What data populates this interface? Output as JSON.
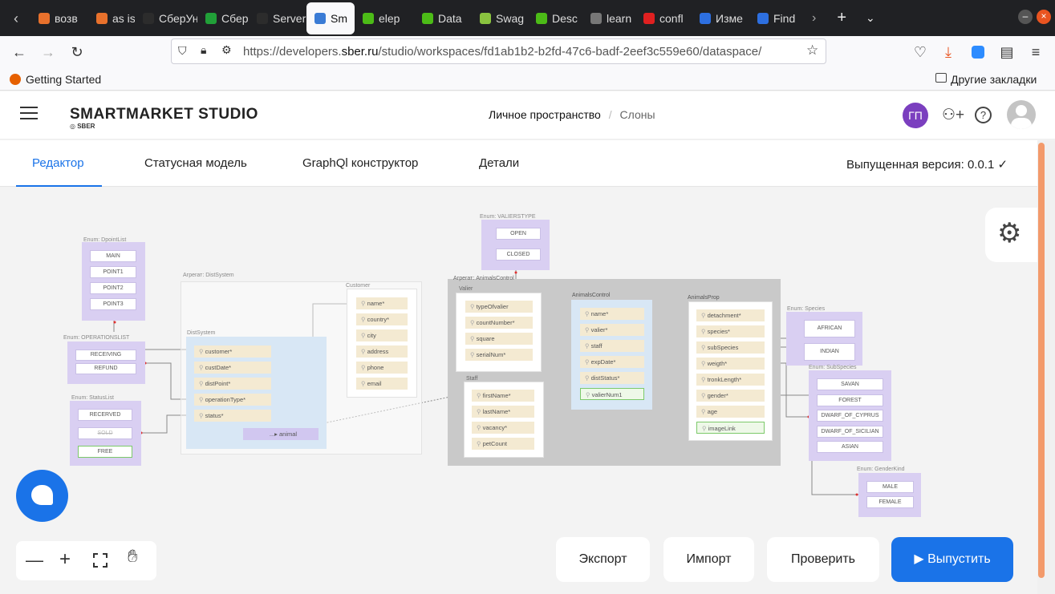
{
  "browser": {
    "tabs": [
      {
        "label": "возв",
        "color": "#e8712c"
      },
      {
        "label": "as is",
        "color": "#e8712c"
      },
      {
        "label": "СберУн",
        "color": "#2c2c2c"
      },
      {
        "label": "Сбер",
        "color": "#21a038"
      },
      {
        "label": "Server E",
        "color": "#2c2c2c"
      },
      {
        "label": "Sm",
        "color": "#3a7bd5"
      },
      {
        "label": "elep",
        "color": "#4cbb17"
      },
      {
        "label": "Data",
        "color": "#4cbb17"
      },
      {
        "label": "Swag",
        "color": "#8ac33f"
      },
      {
        "label": "Desc",
        "color": "#4cbb17"
      },
      {
        "label": "learn",
        "color": "#777777"
      },
      {
        "label": "confl",
        "color": "#e02020"
      },
      {
        "label": "Изме",
        "color": "#2d6fe0"
      },
      {
        "label": "Find",
        "color": "#2d6fe0"
      }
    ],
    "url_prefix": "https://developers.",
    "url_domain": "sber.ru",
    "url_suffix": "/studio/workspaces/fd1ab1b2-b2fd-47c6-badf-2eef3c559e60/dataspace/",
    "bookmark_getting_started": "Getting Started",
    "bookmark_other": "Другие закладки"
  },
  "app": {
    "logo": "SMARTMARKET STUDIO",
    "logo_sub": "SBER",
    "breadcrumb_space": "Личное пространство",
    "breadcrumb_sep": "/",
    "breadcrumb_project": "Слоны",
    "avatar_initials": "ГП",
    "accent": "#7b3fbf"
  },
  "subtabs": {
    "editor": "Редактор",
    "status_model": "Статусная модель",
    "graphql": "GraphQl конструктор",
    "details": "Детали",
    "version": "Выпущенная версия: 0.0.1"
  },
  "actions": {
    "export": "Экспорт",
    "import": "Импорт",
    "check": "Проверить",
    "release": "▶ Выпустить"
  },
  "diagram": {
    "enum_dpointlist": {
      "title": "Enum: DpointList",
      "values": [
        "MAIN",
        "POINT1",
        "POINT2",
        "POINT3"
      ]
    },
    "enum_operationslist": {
      "title": "Enum: OPERATIONSLIST",
      "values": [
        "RECEIVING",
        "REFUND"
      ]
    },
    "enum_statuslist": {
      "title": "Enum: StatusList",
      "values": [
        "RECERVED",
        "SOLD",
        "FREE"
      ]
    },
    "enum_valierstype": {
      "title": "Enum: VALIERSTYPE",
      "values": [
        "OPEN",
        "CLOSED"
      ]
    },
    "enum_species": {
      "title": "Enum: Species",
      "values": [
        "AFRICAN",
        "INDIAN"
      ]
    },
    "enum_subspecies": {
      "title": "Enum: SubSpecies",
      "values": [
        "SAVAN",
        "FOREST",
        "DWARF_OF_CYPRUS",
        "DWARF_OF_SICILIAN",
        "ASIAN"
      ]
    },
    "enum_genderkind": {
      "title": "Enum: GenderKind",
      "values": [
        "MALE",
        "FEMALE"
      ]
    },
    "agg_distsystem": "Агрегат: DistSystem",
    "agg_animalscontrol": "Агрегат: AnimalsControl",
    "distsystem": {
      "title": "DistSystem",
      "fields": [
        "customer*",
        "custDate*",
        "distPoint*",
        "operationType*",
        "status*"
      ],
      "extra": "animal"
    },
    "customer": {
      "title": "Customer",
      "fields": [
        "name*",
        "country*",
        "city",
        "address",
        "phone",
        "email"
      ]
    },
    "valier": {
      "title": "Valier",
      "fields": [
        "typeOfvalier",
        "countNumber*",
        "square",
        "serialNum*"
      ]
    },
    "staff": {
      "title": "Staff",
      "fields": [
        "firstName*",
        "lastName*",
        "vacancy*",
        "petCount"
      ]
    },
    "animalscontrol": {
      "title": "AnimalsControl",
      "fields": [
        "name*",
        "valier*",
        "staff",
        "expDate*",
        "distStatus*",
        "valierNum1"
      ]
    },
    "animalsprop": {
      "title": "AnimalsProp",
      "fields": [
        "detachment*",
        "species*",
        "subSpecies",
        "weigth*",
        "tronkLength*",
        "gender*",
        "age",
        "imageLink"
      ]
    }
  }
}
